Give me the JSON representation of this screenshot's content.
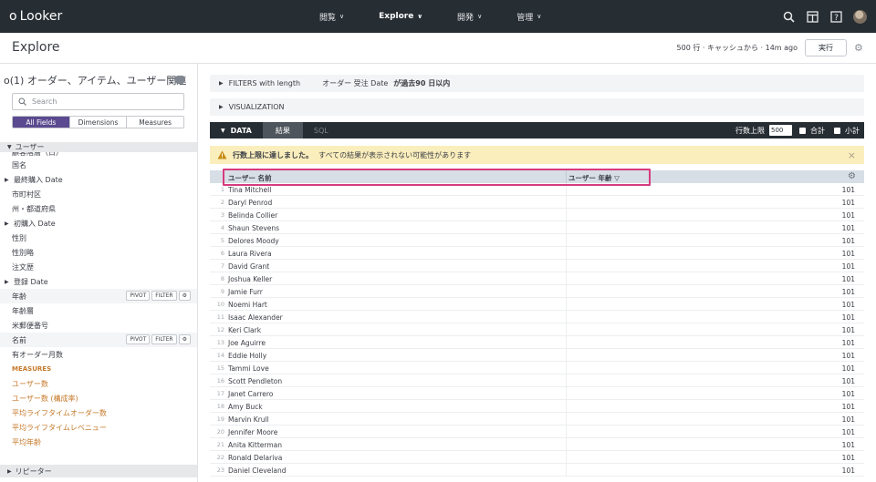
{
  "app": {
    "logo_text": "Looker"
  },
  "nav": {
    "items": [
      {
        "label": "閲覧",
        "active": false
      },
      {
        "label": "Explore",
        "active": true
      },
      {
        "label": "開発",
        "active": false
      },
      {
        "label": "管理",
        "active": false
      }
    ]
  },
  "top_icons": [
    "search-icon",
    "layout-icon",
    "help-icon",
    "avatar"
  ],
  "header": {
    "title": "Explore",
    "status": "500 行 · キャッシュから · 14m ago",
    "run_label": "実行"
  },
  "sidebar": {
    "explore_name": "(1) オーダー、アイテム、ユーザー関連",
    "search_placeholder": "Search",
    "tabs": [
      "All Fields",
      "Dimensions",
      "Measures"
    ],
    "active_tab": "All Fields",
    "view_name": "ユーザー",
    "cut_text": "顧客階層（日）",
    "fields": [
      {
        "label": "国名",
        "expandable": false,
        "selected": false
      },
      {
        "label": "最終購入 Date",
        "expandable": true,
        "selected": false
      },
      {
        "label": "市町村区",
        "expandable": false,
        "selected": false
      },
      {
        "label": "州・都道府県",
        "expandable": false,
        "selected": false
      },
      {
        "label": "初購入 Date",
        "expandable": true,
        "selected": false
      },
      {
        "label": "性別",
        "expandable": false,
        "selected": false
      },
      {
        "label": "性別略",
        "expandable": false,
        "selected": false
      },
      {
        "label": "注文歴",
        "expandable": false,
        "selected": false
      },
      {
        "label": "登録 Date",
        "expandable": true,
        "selected": false
      },
      {
        "label": "年齢",
        "expandable": false,
        "selected": true
      },
      {
        "label": "年齢層",
        "expandable": false,
        "selected": false
      },
      {
        "label": "米郵便番号",
        "expandable": false,
        "selected": false
      },
      {
        "label": "名前",
        "expandable": false,
        "selected": true
      },
      {
        "label": "有オーダー月数",
        "expandable": false,
        "selected": false
      }
    ],
    "pivot_label": "PIVOT",
    "filter_label": "FILTER",
    "measures_heading": "MEASURES",
    "measures": [
      "ユーザー数",
      "ユーザー数 (構成率)",
      "平均ライフタイムオーダー数",
      "平均ライフタイムレベニュー",
      "平均年齢"
    ],
    "next_view": "リピーター"
  },
  "filters": {
    "label": "FILTERS with length",
    "summary_prefix": "オーダー 受注 Date",
    "summary_value": "が過去90 日以内"
  },
  "visualization": {
    "label": "VISUALIZATION"
  },
  "data_bar": {
    "data_label": "DATA",
    "results_label": "結果",
    "sql_label": "SQL",
    "row_limit_label": "行数上限",
    "row_limit_value": "500",
    "totals_label": "合計",
    "subtotals_label": "小計"
  },
  "warning": {
    "bold": "行数上限に達しました。",
    "text": "すべての結果が表示されない可能性があります"
  },
  "table": {
    "columns": [
      "ユーザー 名前",
      "ユーザー 年齢 ▽"
    ],
    "rows": [
      {
        "n": "1",
        "name": "Tina Mitchell",
        "age": "101"
      },
      {
        "n": "2",
        "name": "Daryl Penrod",
        "age": "101"
      },
      {
        "n": "3",
        "name": "Belinda Collier",
        "age": "101"
      },
      {
        "n": "4",
        "name": "Shaun Stevens",
        "age": "101"
      },
      {
        "n": "5",
        "name": "Delores Moody",
        "age": "101"
      },
      {
        "n": "6",
        "name": "Laura Rivera",
        "age": "101"
      },
      {
        "n": "7",
        "name": "David Grant",
        "age": "101"
      },
      {
        "n": "8",
        "name": "Joshua Keller",
        "age": "101"
      },
      {
        "n": "9",
        "name": "Jamie Furr",
        "age": "101"
      },
      {
        "n": "10",
        "name": "Noemi Hart",
        "age": "101"
      },
      {
        "n": "11",
        "name": "Isaac Alexander",
        "age": "101"
      },
      {
        "n": "12",
        "name": "Keri Clark",
        "age": "101"
      },
      {
        "n": "13",
        "name": "Joe Aguirre",
        "age": "101"
      },
      {
        "n": "14",
        "name": "Eddie Holly",
        "age": "101"
      },
      {
        "n": "15",
        "name": "Tammi Love",
        "age": "101"
      },
      {
        "n": "16",
        "name": "Scott Pendleton",
        "age": "101"
      },
      {
        "n": "17",
        "name": "Janet Carrero",
        "age": "101"
      },
      {
        "n": "18",
        "name": "Amy Buck",
        "age": "101"
      },
      {
        "n": "19",
        "name": "Marvin Krull",
        "age": "101"
      },
      {
        "n": "20",
        "name": "Jennifer Moore",
        "age": "101"
      },
      {
        "n": "21",
        "name": "Anita Kitterman",
        "age": "101"
      },
      {
        "n": "22",
        "name": "Ronald Delariva",
        "age": "101"
      },
      {
        "n": "23",
        "name": "Daniel Cleveland",
        "age": "101"
      }
    ]
  },
  "colors": {
    "topbar": "#262d33",
    "accent_purple": "#5b4a8f",
    "measure_orange": "#c6792b",
    "warning_bg": "#fbeebd",
    "highlight": "#d63b7e"
  }
}
